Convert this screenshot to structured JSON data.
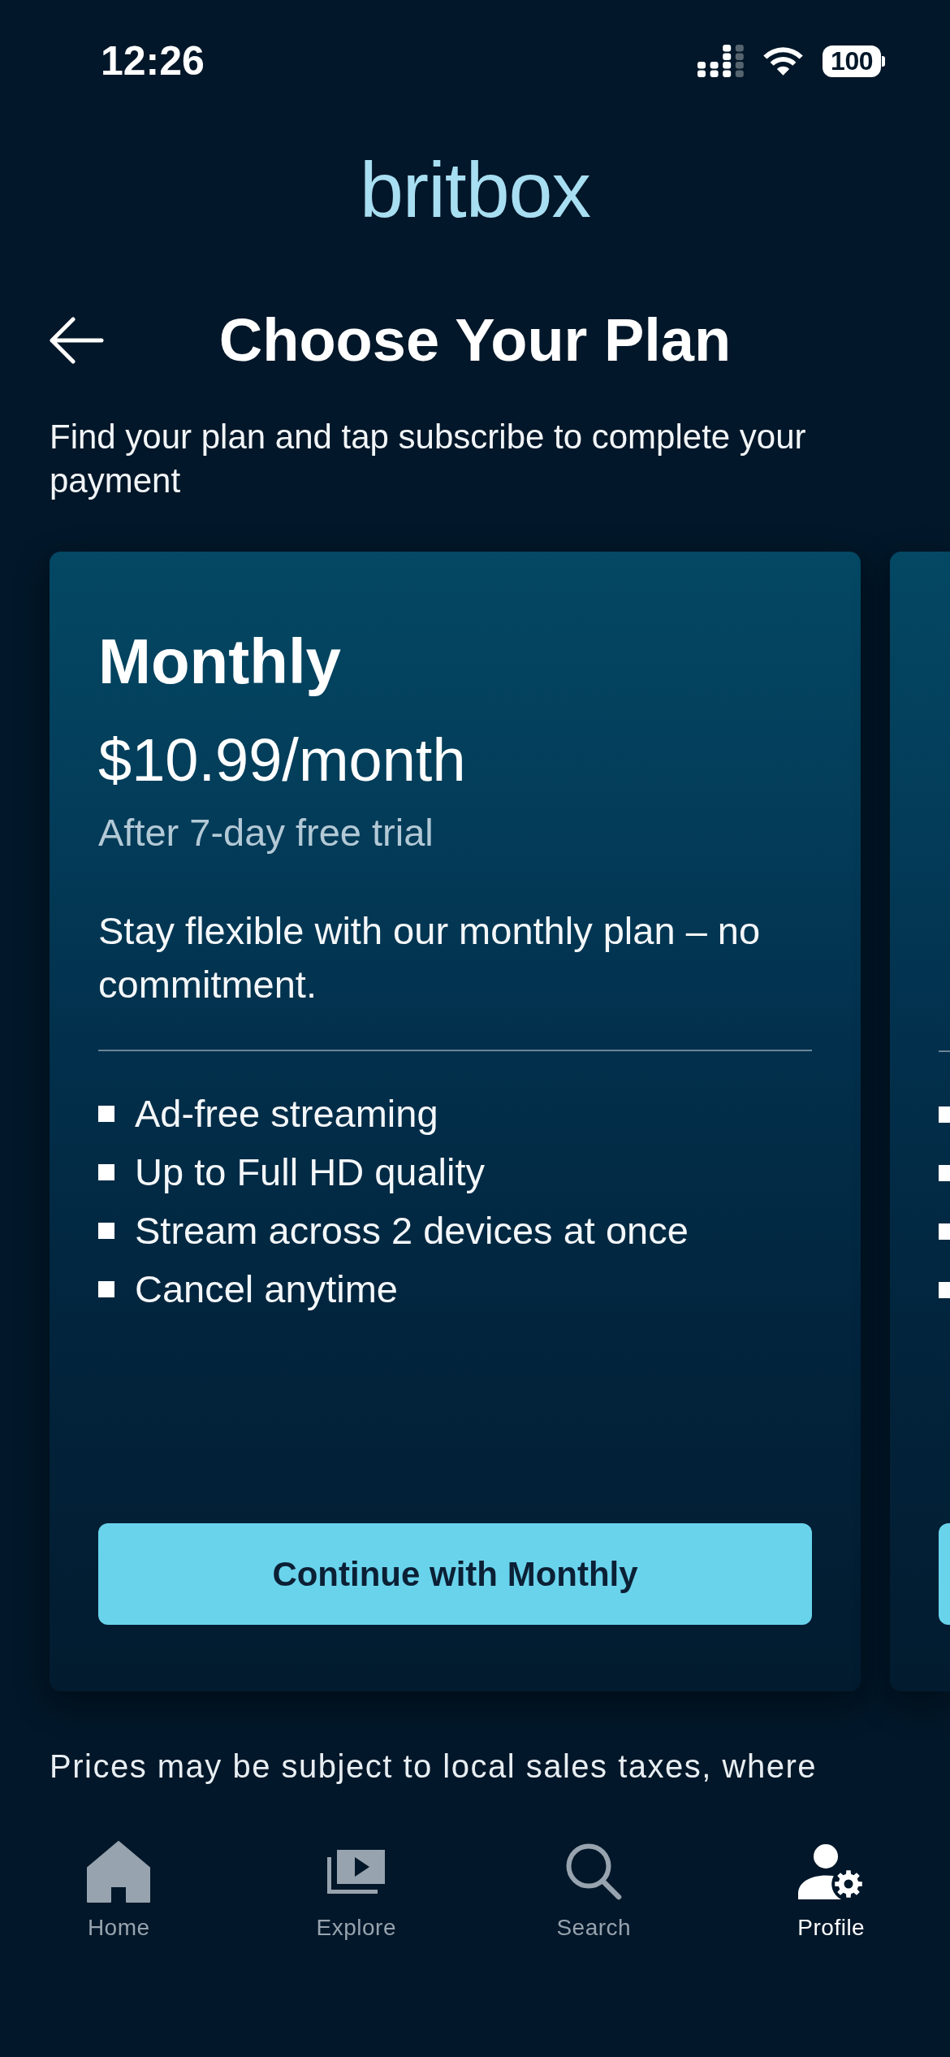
{
  "status_bar": {
    "time": "12:26",
    "battery": "100"
  },
  "header": {
    "logo": "britbox",
    "title": "Choose Your Plan",
    "subtitle": "Find your plan and tap subscribe to complete your payment"
  },
  "plans": [
    {
      "kind": "full",
      "name": "Monthly",
      "price": "$10.99/month",
      "trial": "After 7-day free trial",
      "description": "Stay flexible with our monthly plan – no commitment.",
      "features": [
        "Ad-free streaming",
        "Up to Full HD quality",
        "Stream across 2 devices at once",
        "Cancel anytime"
      ],
      "button": "Continue with Monthly"
    },
    {
      "kind": "peek"
    }
  ],
  "disclaimer": "Prices may be subject to local sales taxes, where",
  "tab_bar": {
    "items": [
      {
        "label": "Home",
        "selected": false
      },
      {
        "label": "Explore",
        "selected": false
      },
      {
        "label": "Search",
        "selected": false
      },
      {
        "label": "Profile",
        "selected": true
      }
    ]
  }
}
